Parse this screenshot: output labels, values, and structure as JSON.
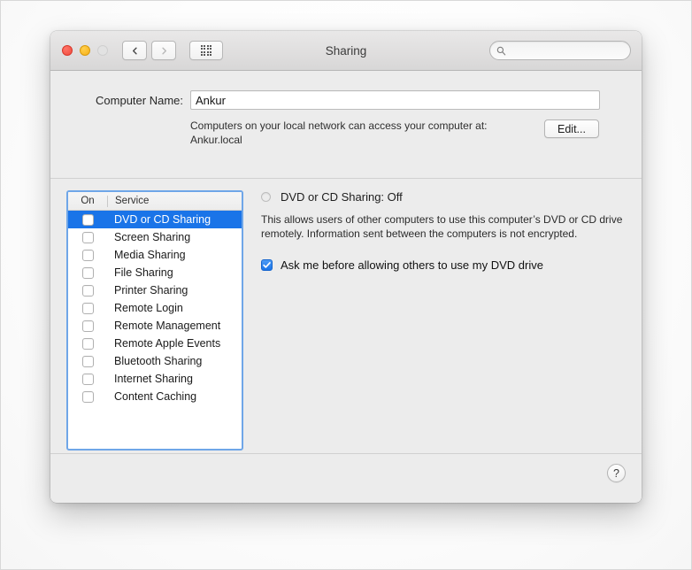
{
  "window": {
    "title": "Sharing",
    "traffic_lights": {
      "close": "close-button",
      "minimize": "minimize-button",
      "zoom": "zoom-button"
    },
    "nav": {
      "back": "back-chevron",
      "forward": "forward-chevron",
      "grid": "show-all-grid"
    },
    "search": {
      "value": "",
      "placeholder": ""
    }
  },
  "computer_name": {
    "label": "Computer Name:",
    "value": "Ankur",
    "description": "Computers on your local network can access your computer at:",
    "hostname": "Ankur.local",
    "edit_label": "Edit..."
  },
  "service_list": {
    "columns": {
      "on": "On",
      "service": "Service"
    },
    "items": [
      {
        "label": "DVD or CD Sharing",
        "checked": false,
        "selected": true
      },
      {
        "label": "Screen Sharing",
        "checked": false,
        "selected": false
      },
      {
        "label": "Media Sharing",
        "checked": false,
        "selected": false
      },
      {
        "label": "File Sharing",
        "checked": false,
        "selected": false
      },
      {
        "label": "Printer Sharing",
        "checked": false,
        "selected": false
      },
      {
        "label": "Remote Login",
        "checked": false,
        "selected": false
      },
      {
        "label": "Remote Management",
        "checked": false,
        "selected": false
      },
      {
        "label": "Remote Apple Events",
        "checked": false,
        "selected": false
      },
      {
        "label": "Bluetooth Sharing",
        "checked": false,
        "selected": false
      },
      {
        "label": "Internet Sharing",
        "checked": false,
        "selected": false
      },
      {
        "label": "Content Caching",
        "checked": false,
        "selected": false
      }
    ]
  },
  "detail": {
    "status_title": "DVD or CD Sharing: Off",
    "status_on": false,
    "description": "This allows users of other computers to use this computer’s DVD or CD drive remotely. Information sent between the computers is not encrypted.",
    "ask_label": "Ask me before allowing others to use my DVD drive",
    "ask_checked": true
  },
  "footer": {
    "help_label": "?"
  },
  "colors": {
    "selection_blue": "#1a74e8",
    "focus_ring": "#6fa6e8",
    "window_bg": "#ececec",
    "titlebar_bg": "#dedddd"
  }
}
